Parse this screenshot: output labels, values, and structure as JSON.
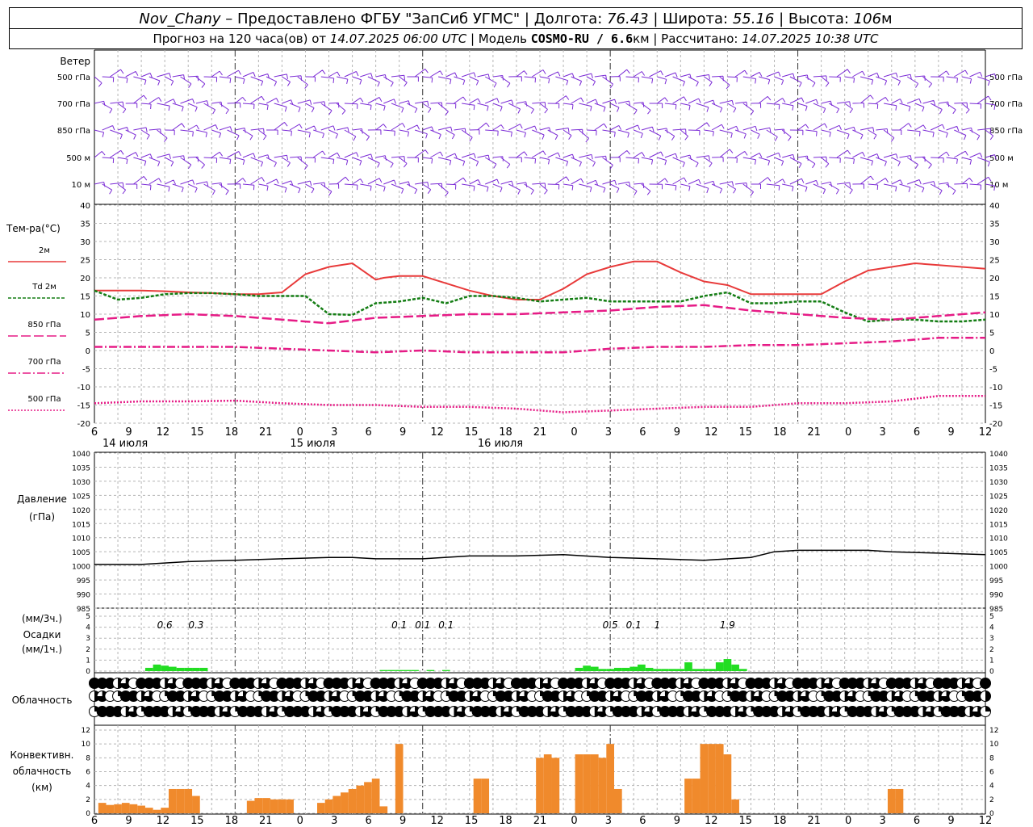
{
  "header": {
    "station": "Nov_Chany",
    "provider": "– Предоставлено ФГБУ \"ЗапСиб УГМС\" |",
    "lon_label": "Долгота:",
    "lon_value": "76.43",
    "lat_label": "| Широта:",
    "lat_value": "55.16",
    "alt_label": "| Высота:",
    "alt_value": "106",
    "alt_unit": "м",
    "forecast_prefix": "Прогноз на 120 часа(ов) от",
    "forecast_start": "14.07.2025 06:00 UTC",
    "model_label": "| Модель",
    "model_name": "COSMO-RU / 6.6",
    "model_unit": "км",
    "calc_label": "| Рассчитано:",
    "calc_time": "14.07.2025 10:38 UTC"
  },
  "time_axis": {
    "hour_ticks": [
      "6",
      "9",
      "12",
      "15",
      "18",
      "21",
      "0",
      "3",
      "6",
      "9",
      "12",
      "15",
      "18",
      "21",
      "0",
      "3",
      "6",
      "9",
      "12",
      "15",
      "18",
      "21",
      "0",
      "3",
      "6",
      "9",
      "12"
    ],
    "days": [
      "14 июля",
      "15 июля",
      "16 июля"
    ]
  },
  "wind": {
    "title": "Ветер",
    "levels": [
      "500 гПа",
      "700 гПа",
      "850 гПа",
      "500 м",
      "10 м"
    ],
    "color": "#7b2bd6"
  },
  "temperature": {
    "title": "Тем-ра(°С)",
    "legend": [
      {
        "label": "2м",
        "color": "#e83a3a",
        "style": "solid"
      },
      {
        "label": "Td 2м",
        "color": "#137d13",
        "style": "dashed"
      },
      {
        "label": "850 гПа",
        "color": "#e61b86",
        "style": "longdash"
      },
      {
        "label": "700 гПа",
        "color": "#e61b86",
        "style": "dashdot"
      },
      {
        "label": "500 гПа",
        "color": "#e61b86",
        "style": "dotted"
      }
    ],
    "y_ticks": [
      "40",
      "35",
      "30",
      "25",
      "20",
      "15",
      "10",
      "5",
      "0",
      "-5",
      "-10",
      "-15",
      "-20"
    ]
  },
  "pressure": {
    "title_1": "Давление",
    "title_2": "(гПа)",
    "y_ticks": [
      "1040",
      "1035",
      "1030",
      "1025",
      "1020",
      "1015",
      "1010",
      "1005",
      "1000",
      "995",
      "990",
      "985"
    ]
  },
  "precip": {
    "title_1": "(мм/3ч.)",
    "title_2": "Осадки",
    "title_3": "(мм/1ч.)",
    "y_ticks": [
      "5",
      "4",
      "3",
      "2",
      "1",
      "0"
    ],
    "totals": [
      {
        "hour": 9,
        "text": "0.6"
      },
      {
        "hour": 13,
        "text": "0.3"
      },
      {
        "hour": 39,
        "text": "0.1"
      },
      {
        "hour": 42,
        "text": "0.1"
      },
      {
        "hour": 45,
        "text": "0.1"
      },
      {
        "hour": 66,
        "text": "0.5"
      },
      {
        "hour": 69,
        "text": "0.1"
      },
      {
        "hour": 72,
        "text": "1"
      },
      {
        "hour": 81,
        "text": "1.9"
      }
    ],
    "color": "#22dd22"
  },
  "clouds": {
    "title": "Облачность"
  },
  "convective": {
    "title_1": "Конвективн.",
    "title_2": "облачность",
    "title_3": "(км)",
    "y_ticks": [
      "12",
      "10",
      "8",
      "6",
      "4",
      "2",
      "0"
    ],
    "color": "#f08a2c"
  },
  "chart_data": [
    {
      "type": "line",
      "title": "Тем-ра(°С)",
      "x_unit": "hours from 14.07.2025 06:00 UTC",
      "ylim": [
        -20,
        40
      ],
      "grid": true,
      "series": [
        {
          "name": "2м",
          "x": [
            0,
            3,
            6,
            9,
            12,
            15,
            18,
            21,
            24,
            27,
            30,
            33,
            36,
            37,
            39,
            42,
            45,
            48,
            51,
            54,
            57,
            60,
            63,
            66,
            69,
            72,
            75,
            78,
            81,
            84,
            87,
            90,
            93,
            96,
            99,
            102,
            105,
            108,
            111,
            114
          ],
          "values": [
            16.5,
            16.5,
            16.5,
            16.3,
            16,
            15.8,
            15.5,
            15.5,
            16,
            21,
            23,
            24,
            19.5,
            20,
            20.5,
            20.5,
            18.5,
            16.5,
            15,
            14,
            14,
            17,
            21,
            23,
            24.5,
            24.5,
            21.5,
            19,
            18,
            15.5,
            15.5,
            15.5,
            15.5,
            19,
            22,
            23,
            24,
            23.5,
            23,
            22.5
          ]
        },
        {
          "name": "Td 2м",
          "x": [
            0,
            3,
            6,
            9,
            12,
            15,
            18,
            21,
            24,
            27,
            30,
            33,
            36,
            39,
            42,
            45,
            48,
            51,
            54,
            57,
            60,
            63,
            66,
            69,
            72,
            75,
            78,
            81,
            84,
            87,
            90,
            93,
            96,
            99,
            102,
            105,
            108,
            111,
            114
          ],
          "values": [
            16.5,
            14,
            14.5,
            15.5,
            15.8,
            15.8,
            15.5,
            15,
            15,
            15,
            10,
            9.8,
            13,
            13.5,
            14.5,
            13,
            15,
            15,
            14.5,
            13.5,
            14,
            14.5,
            13.5,
            13.5,
            13.5,
            13.5,
            15,
            16,
            13,
            13,
            13.5,
            13.5,
            10.5,
            8,
            8.5,
            8.5,
            8,
            8,
            8.5
          ]
        },
        {
          "name": "850 гПа",
          "x": [
            0,
            6,
            12,
            18,
            24,
            30,
            36,
            42,
            48,
            54,
            60,
            66,
            72,
            78,
            84,
            90,
            96,
            102,
            108,
            114
          ],
          "values": [
            8.5,
            9.5,
            10,
            9.5,
            8.5,
            7.5,
            9,
            9.5,
            10,
            10,
            10.5,
            11,
            12,
            12.5,
            11,
            10,
            9,
            8.5,
            9.5,
            10.5
          ]
        },
        {
          "name": "700 гПа",
          "x": [
            0,
            6,
            12,
            18,
            24,
            30,
            36,
            42,
            48,
            54,
            60,
            66,
            72,
            78,
            84,
            90,
            96,
            102,
            108,
            114
          ],
          "values": [
            1,
            1,
            1,
            1,
            0.5,
            0,
            -0.5,
            0,
            -0.5,
            -0.5,
            -0.5,
            0.5,
            1,
            1,
            1.5,
            1.5,
            2,
            2.5,
            3.5,
            3.5
          ]
        },
        {
          "name": "500 гПа",
          "x": [
            0,
            6,
            12,
            18,
            24,
            30,
            36,
            42,
            48,
            54,
            60,
            66,
            72,
            78,
            84,
            90,
            96,
            102,
            108,
            114
          ],
          "values": [
            -14.5,
            -14,
            -14,
            -13.8,
            -14.5,
            -15,
            -15,
            -15.5,
            -15.5,
            -16,
            -17,
            -16.5,
            -16,
            -15.5,
            -15.5,
            -14.5,
            -14.5,
            -14,
            -12.5,
            -12.5
          ]
        }
      ]
    },
    {
      "type": "line",
      "title": "Давление (гПа)",
      "x_unit": "hours from 14.07.2025 06:00 UTC",
      "ylim": [
        985,
        1040
      ],
      "grid": true,
      "series": [
        {
          "name": "Давление",
          "x": [
            0,
            6,
            12,
            18,
            24,
            30,
            33,
            36,
            39,
            42,
            48,
            54,
            60,
            66,
            72,
            78,
            84,
            87,
            90,
            93,
            96,
            99,
            102,
            108,
            114
          ],
          "values": [
            1000.5,
            1000.5,
            1001.5,
            1002,
            1002.5,
            1003,
            1003,
            1002.5,
            1002.5,
            1002.5,
            1003.5,
            1003.5,
            1004,
            1003,
            1002.5,
            1002,
            1003,
            1005,
            1005.5,
            1005.5,
            1005.5,
            1005.5,
            1005,
            1004.5,
            1004
          ]
        }
      ]
    },
    {
      "type": "bar",
      "title": "Осадки (мм/1ч.)",
      "x_unit": "hours from 14.07.2025 06:00 UTC",
      "ylim": [
        0,
        5
      ],
      "x": [
        7,
        8,
        9,
        10,
        11,
        12,
        13,
        14,
        37,
        38,
        39,
        40,
        41,
        43,
        45,
        62,
        63,
        64,
        65,
        66,
        67,
        68,
        69,
        70,
        71,
        72,
        73,
        74,
        75,
        76,
        77,
        78,
        79,
        80,
        81,
        82,
        83
      ],
      "values": [
        0.3,
        0.6,
        0.5,
        0.4,
        0.3,
        0.3,
        0.3,
        0.3,
        0.1,
        0.1,
        0.1,
        0.1,
        0.1,
        0.1,
        0.1,
        0.3,
        0.5,
        0.4,
        0.2,
        0.2,
        0.3,
        0.3,
        0.4,
        0.6,
        0.3,
        0.2,
        0.2,
        0.2,
        0.2,
        0.8,
        0.2,
        0.2,
        0.2,
        0.8,
        1.1,
        0.6,
        0.2
      ]
    },
    {
      "type": "bar",
      "title": "Конвективн. облачность (км)",
      "x_unit": "hours from 14.07.2025 06:00 UTC",
      "ylim": [
        0,
        12
      ],
      "x": [
        0,
        1,
        2,
        3,
        4,
        5,
        6,
        7,
        8,
        9,
        10,
        11,
        12,
        13,
        14,
        15,
        16,
        17,
        18,
        19,
        20,
        21,
        22,
        23,
        24,
        25,
        26,
        27,
        28,
        29,
        30,
        31,
        32,
        33,
        34,
        35,
        36,
        37,
        38,
        39,
        40,
        41,
        42,
        43,
        44,
        45,
        46,
        47,
        48,
        49,
        50,
        51,
        52,
        53,
        54,
        55,
        56,
        57,
        58,
        59,
        60,
        61,
        62,
        63,
        64,
        65,
        66,
        67,
        68,
        69,
        70,
        71,
        72,
        73,
        74,
        75,
        76,
        77,
        78,
        79,
        80,
        81,
        82,
        83,
        84,
        85,
        86,
        87,
        88,
        89,
        90,
        91,
        92,
        93,
        94,
        95,
        96,
        97,
        98,
        99,
        100,
        101,
        102,
        103,
        104,
        105,
        106,
        107,
        108,
        109,
        110,
        111,
        112,
        113,
        114,
        115
      ],
      "values": [
        0,
        1.5,
        1.2,
        1.3,
        1.5,
        1.3,
        1.1,
        0.8,
        0.5,
        0.8,
        3.5,
        3.5,
        3.5,
        2.5,
        0,
        0,
        0,
        0,
        0,
        0,
        1.8,
        2.2,
        2.2,
        2.0,
        2.0,
        2.0,
        0,
        0,
        0,
        1.5,
        2.0,
        2.5,
        3.0,
        3.5,
        4.0,
        4.5,
        5.0,
        1.0,
        0,
        10.0,
        0,
        0,
        0,
        0,
        0,
        0,
        0,
        0,
        0,
        5.0,
        5.0,
        0,
        0,
        0,
        0,
        0,
        0,
        8.0,
        8.5,
        8.0,
        0,
        0,
        8.5,
        8.5,
        8.5,
        8.0,
        10.0,
        3.5,
        0,
        0,
        0,
        0,
        0,
        0,
        0,
        0,
        5.0,
        5.0,
        10.0,
        10.0,
        10.0,
        8.5,
        2.0,
        0,
        0,
        0,
        0,
        0,
        0,
        0,
        0,
        0,
        0,
        0,
        0,
        0,
        0,
        0,
        0,
        0,
        0,
        0,
        3.5,
        3.5,
        0,
        0,
        0,
        0,
        0,
        0,
        0,
        0,
        0,
        0,
        0,
        0
      ]
    }
  ]
}
